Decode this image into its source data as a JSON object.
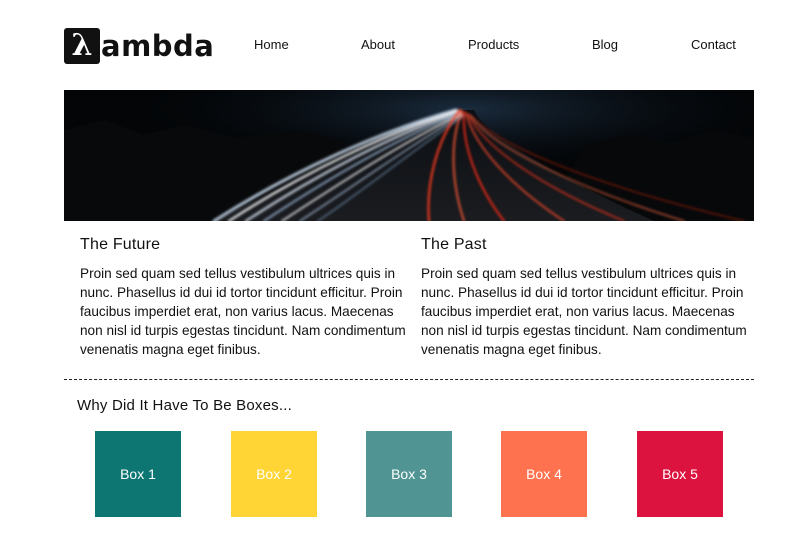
{
  "header": {
    "logo_text": "ambda",
    "logo_glyph": "λ",
    "nav": [
      {
        "label": "Home"
      },
      {
        "label": "About"
      },
      {
        "label": "Products"
      },
      {
        "label": "Blog"
      },
      {
        "label": "Contact"
      }
    ]
  },
  "articles": [
    {
      "title": "The Future",
      "body": "Proin sed quam sed tellus vestibulum ultrices quis in nunc. Phasellus id dui id tortor tincidunt efficitur. Proin faucibus imperdiet erat, non varius lacus. Maecenas non nisl id turpis egestas tincidunt. Nam condimentum venenatis magna eget finibus."
    },
    {
      "title": "The Past",
      "body": "Proin sed quam sed tellus vestibulum ultrices quis in nunc. Phasellus id dui id tortor tincidunt efficitur. Proin faucibus imperdiet erat, non varius lacus. Maecenas non nisl id turpis egestas tincidunt. Nam condimentum venenatis magna eget finibus."
    }
  ],
  "boxes": {
    "title": "Why Did It Have To Be Boxes...",
    "items": [
      {
        "label": "Box 1",
        "color": "#0d7672"
      },
      {
        "label": "Box 2",
        "color": "#fed534"
      },
      {
        "label": "Box 3",
        "color": "#509593"
      },
      {
        "label": "Box 4",
        "color": "#ff7250"
      },
      {
        "label": "Box 5",
        "color": "#db133e"
      }
    ]
  },
  "colors": {
    "text": "#111111",
    "hero_background": "#030507",
    "light_trail_white": "#dfe9f6",
    "light_trail_red": "#ff3b1f"
  }
}
